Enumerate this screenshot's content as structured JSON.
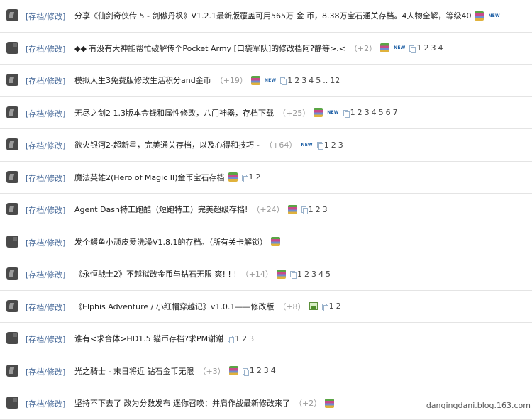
{
  "category_label": "[存档/修改]",
  "threads": [
    {
      "title": "分享《仙剑奇侠传 5 - 剑傲丹枫》V1.2.1最新版覆盖可用565万 金 币，8.38万宝石通关存档。4人物全解，等级40",
      "reply": "",
      "icons": [
        "stack",
        "new"
      ],
      "pages": []
    },
    {
      "title": "◆◆ 有没有大神能帮忙破解传个Pocket Army [口袋军队]的修改档阿?静等>.<",
      "reply": "（+2）",
      "icons": [
        "stack",
        "new"
      ],
      "pages": [
        "1",
        "2",
        "3",
        "4"
      ]
    },
    {
      "title": "模拟人生3免费版修改生活积分and金币",
      "reply": "（+19）",
      "icons": [
        "stack",
        "new"
      ],
      "pages": [
        "1",
        "2",
        "3",
        "4",
        "5",
        "..",
        "12"
      ]
    },
    {
      "title": "无尽之剑2 1.3版本金钱和属性修改，八门神器，存档下载",
      "reply": "（+25）",
      "icons": [
        "stack",
        "new"
      ],
      "pages": [
        "1",
        "2",
        "3",
        "4",
        "5",
        "6",
        "7"
      ]
    },
    {
      "title": "欲火银河2-超新星，完美通关存档，以及心得和技巧~",
      "reply": "（+64）",
      "icons": [
        "new"
      ],
      "pages": [
        "1",
        "2",
        "3"
      ]
    },
    {
      "title": "魔法英雄2(Hero of Magic II)金币宝石存档",
      "reply": "",
      "icons": [
        "stack"
      ],
      "pages": [
        "1",
        "2"
      ]
    },
    {
      "title": "Agent Dash特工跑酷（短跑特工）完美超级存档!",
      "reply": "（+24）",
      "icons": [
        "stack"
      ],
      "pages": [
        "1",
        "2",
        "3"
      ]
    },
    {
      "title": "发个鳄鱼小顽皮爱洗澡V1.8.1的存档。（所有关卡解锁）",
      "reply": "",
      "icons": [
        "stack"
      ],
      "pages": []
    },
    {
      "title": "《永恒战士2》不越狱改金币与钻石无限 爽! ! !",
      "reply": "（+14）",
      "icons": [
        "stack"
      ],
      "pages": [
        "1",
        "2",
        "3",
        "4",
        "5"
      ]
    },
    {
      "title": "《Elphis Adventure / 小红帽穿越记》v1.0.1——修改版",
      "reply": "（+8）",
      "icons": [
        "image"
      ],
      "pages": [
        "1",
        "2"
      ]
    },
    {
      "title": "谁有<求合体>HD1.5 猫币存档?求PM谢谢",
      "reply": "",
      "icons": [],
      "pages": [
        "1",
        "2",
        "3"
      ]
    },
    {
      "title": "光之骑士 - 末日将近  钻石金币无限",
      "reply": "（+3）",
      "icons": [
        "stack"
      ],
      "pages": [
        "1",
        "2",
        "3",
        "4"
      ]
    },
    {
      "title": "坚持不下去了 改为分数发布 迷你召唤：并肩作战最新修改来了",
      "reply": "（+2）",
      "icons": [
        "stack"
      ],
      "pages": []
    }
  ],
  "new_label": "NEW",
  "watermark": "danqingdani.blog.163.com"
}
